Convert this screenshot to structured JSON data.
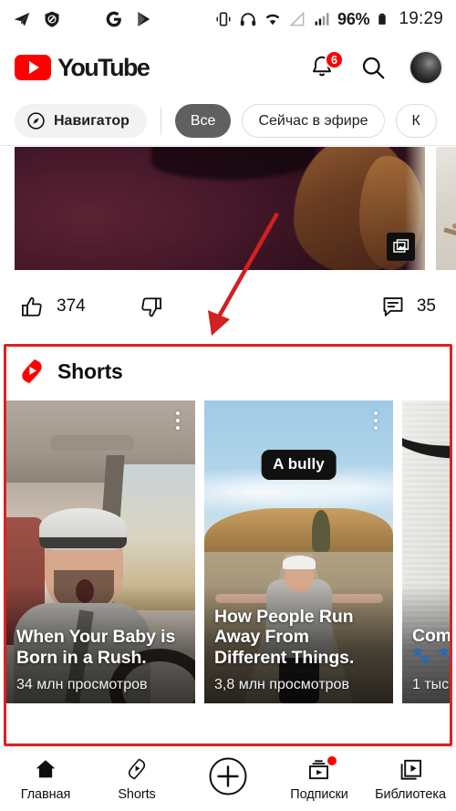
{
  "status_bar": {
    "left_icons": [
      "telegram-icon",
      "adblock-shield-icon",
      "google-icon",
      "play-store-icon"
    ],
    "right_icons": [
      "vibrate-icon",
      "headphones-icon",
      "wifi-icon",
      "signal-empty-icon",
      "signal-bars-icon"
    ],
    "battery_percent": "96%",
    "time": "19:29"
  },
  "header": {
    "logo_text": "YouTube",
    "notification_count": "6",
    "icons": {
      "bell": "notifications-bell-icon",
      "search": "search-icon",
      "avatar": "account-avatar"
    }
  },
  "chips": {
    "navigator": {
      "label": "Навигатор",
      "icon": "compass-icon"
    },
    "items": [
      {
        "label": "Все",
        "active": true
      },
      {
        "label": "Сейчас в эфире",
        "active": false
      },
      {
        "label": "К",
        "active": false
      }
    ]
  },
  "feed_item": {
    "multi_image_badge": "multi-image-icon",
    "likes": "374",
    "dislike_icon": "thumbs-down-icon",
    "like_icon": "thumbs-up-icon",
    "comment_icon": "comment-icon",
    "comments": "35"
  },
  "shorts_shelf": {
    "title": "Shorts",
    "logo": "shorts-logo-icon",
    "cards": [
      {
        "title": "When Your Baby is Born in a Rush.",
        "views": "34 млн просмотров",
        "overlay_text": "",
        "menu_icon": "kebab-menu-icon"
      },
      {
        "title": "How People Run Away From Different Things.",
        "views": "3,8 млн просмотров",
        "overlay_text": "A bully",
        "menu_icon": "kebab-menu-icon"
      },
      {
        "title": "Com",
        "views": "1 тыс",
        "overlay_text": "",
        "menu_icon": "kebab-menu-icon"
      }
    ]
  },
  "annotation": {
    "box_color": "#e02020",
    "arrow_color": "#d32020"
  },
  "bottom_nav": {
    "items": [
      {
        "label": "Главная",
        "icon": "home-icon",
        "active": true,
        "badge": false
      },
      {
        "label": "Shorts",
        "icon": "shorts-icon",
        "active": false,
        "badge": false
      },
      {
        "label": "",
        "icon": "create-plus-icon",
        "active": false,
        "badge": false
      },
      {
        "label": "Подписки",
        "icon": "subscriptions-icon",
        "active": false,
        "badge": true
      },
      {
        "label": "Библиотека",
        "icon": "library-icon",
        "active": false,
        "badge": false
      }
    ]
  }
}
